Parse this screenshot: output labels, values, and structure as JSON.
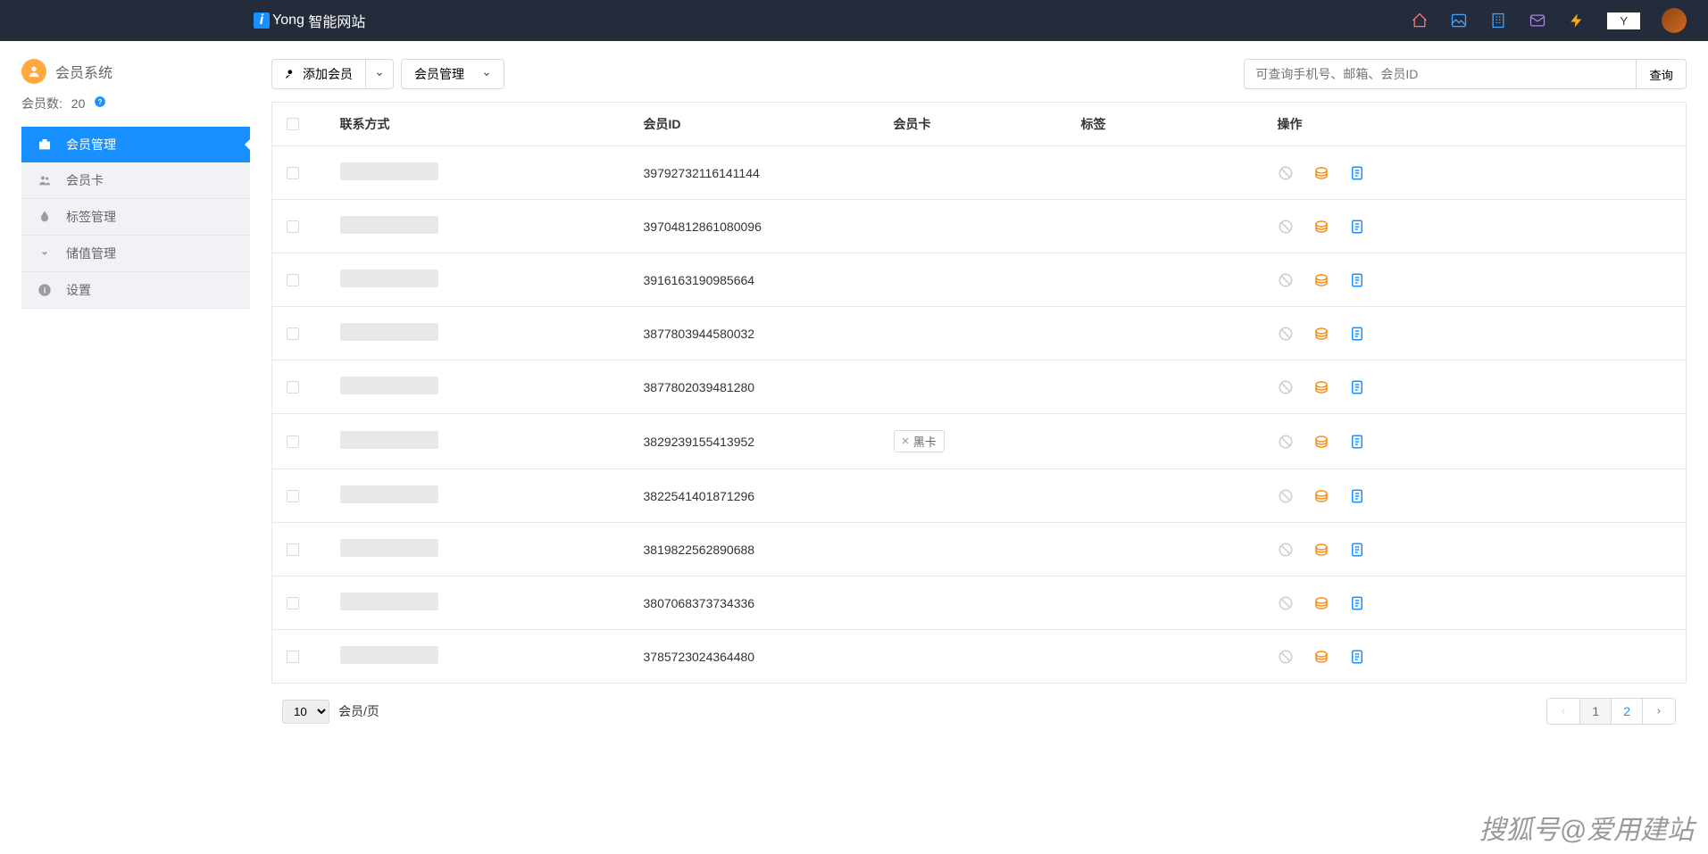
{
  "brand": {
    "badge_letter": "i",
    "name": "Yong",
    "suffix": "智能网站"
  },
  "nav_user": "Y",
  "sidebar": {
    "title": "会员系统",
    "count_label": "会员数:",
    "count_value": "20",
    "items": [
      {
        "label": "会员管理"
      },
      {
        "label": "会员卡"
      },
      {
        "label": "标签管理"
      },
      {
        "label": "储值管理"
      },
      {
        "label": "设置"
      }
    ]
  },
  "toolbar": {
    "add_member": "添加会员",
    "manage_member": "会员管理",
    "search_placeholder": "可查询手机号、邮箱、会员ID",
    "search_btn": "查询"
  },
  "table": {
    "headers": {
      "contact": "联系方式",
      "member_id": "会员ID",
      "card": "会员卡",
      "tag": "标签",
      "action": "操作"
    },
    "rows": [
      {
        "id": "39792732116141144",
        "card": ""
      },
      {
        "id": "39704812861080096",
        "card": ""
      },
      {
        "id": "3916163190985664",
        "card": ""
      },
      {
        "id": "3877803944580032",
        "card": ""
      },
      {
        "id": "3877802039481280",
        "card": ""
      },
      {
        "id": "3829239155413952",
        "card": "黑卡"
      },
      {
        "id": "3822541401871296",
        "card": ""
      },
      {
        "id": "3819822562890688",
        "card": ""
      },
      {
        "id": "3807068373734336",
        "card": ""
      },
      {
        "id": "3785723024364480",
        "card": ""
      }
    ]
  },
  "footer": {
    "page_size_options": [
      "10"
    ],
    "page_size_label": "会员/页",
    "pages": [
      "1",
      "2"
    ],
    "current_page": 1
  },
  "watermark": "搜狐号@爱用建站"
}
